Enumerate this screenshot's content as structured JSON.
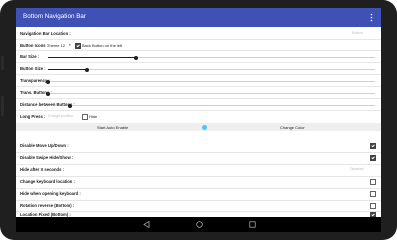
{
  "app": {
    "title": "Bottom Navigation Bar"
  },
  "settings": {
    "nav_location": {
      "label": "Navigation Bar Location :",
      "hint": "Bottom"
    },
    "button_icons": {
      "label": "Button Icons :",
      "theme_value": "Theme 12",
      "back_left_checked": true,
      "back_left_label": "Back Button on the left"
    },
    "bar_size": {
      "label": "Bar Size :",
      "fraction": 0.27
    },
    "button_size": {
      "label": "Button Size :",
      "fraction": 0.12
    },
    "transparency": {
      "label": "Transparency :",
      "fraction": 0.0
    },
    "trans_buttons": {
      "label": "Trans. Buttons :",
      "fraction": 0.0
    },
    "distance_buttons": {
      "label": "Distance between Buttons :",
      "fraction": 0.0
    },
    "long_press": {
      "label": "Long Press :",
      "hint": "Change position",
      "hide_checked": false,
      "hide_label": "Hide"
    },
    "actions": {
      "start_label": "Start Auto Enable",
      "change_color_label": "Change Color"
    },
    "disable_move": {
      "label": "Disable Move Up/Down :",
      "checked": true
    },
    "disable_swipe": {
      "label": "Disable Swipe Hide/Show :",
      "checked": true
    },
    "hide_after": {
      "label": "Hide after X seconds :",
      "hint": "Disabled"
    },
    "change_keyboard": {
      "label": "Change keyboard location :",
      "checked": false
    },
    "hide_keyboard": {
      "label": "Hide when opening keyboard :",
      "checked": false
    },
    "rotation_reverse": {
      "label": "Rotation reverse (Bottom) :",
      "checked": false
    },
    "location_fixed": {
      "label": "Location Fixed (Bottom) :",
      "checked": true
    }
  },
  "colors": {
    "appbar": "#3f51b5",
    "accent_icon": "#4fc3f7"
  },
  "icons": [
    "more-vert-icon",
    "palette-icon",
    "back-icon",
    "home-icon",
    "recent-apps-icon"
  ]
}
